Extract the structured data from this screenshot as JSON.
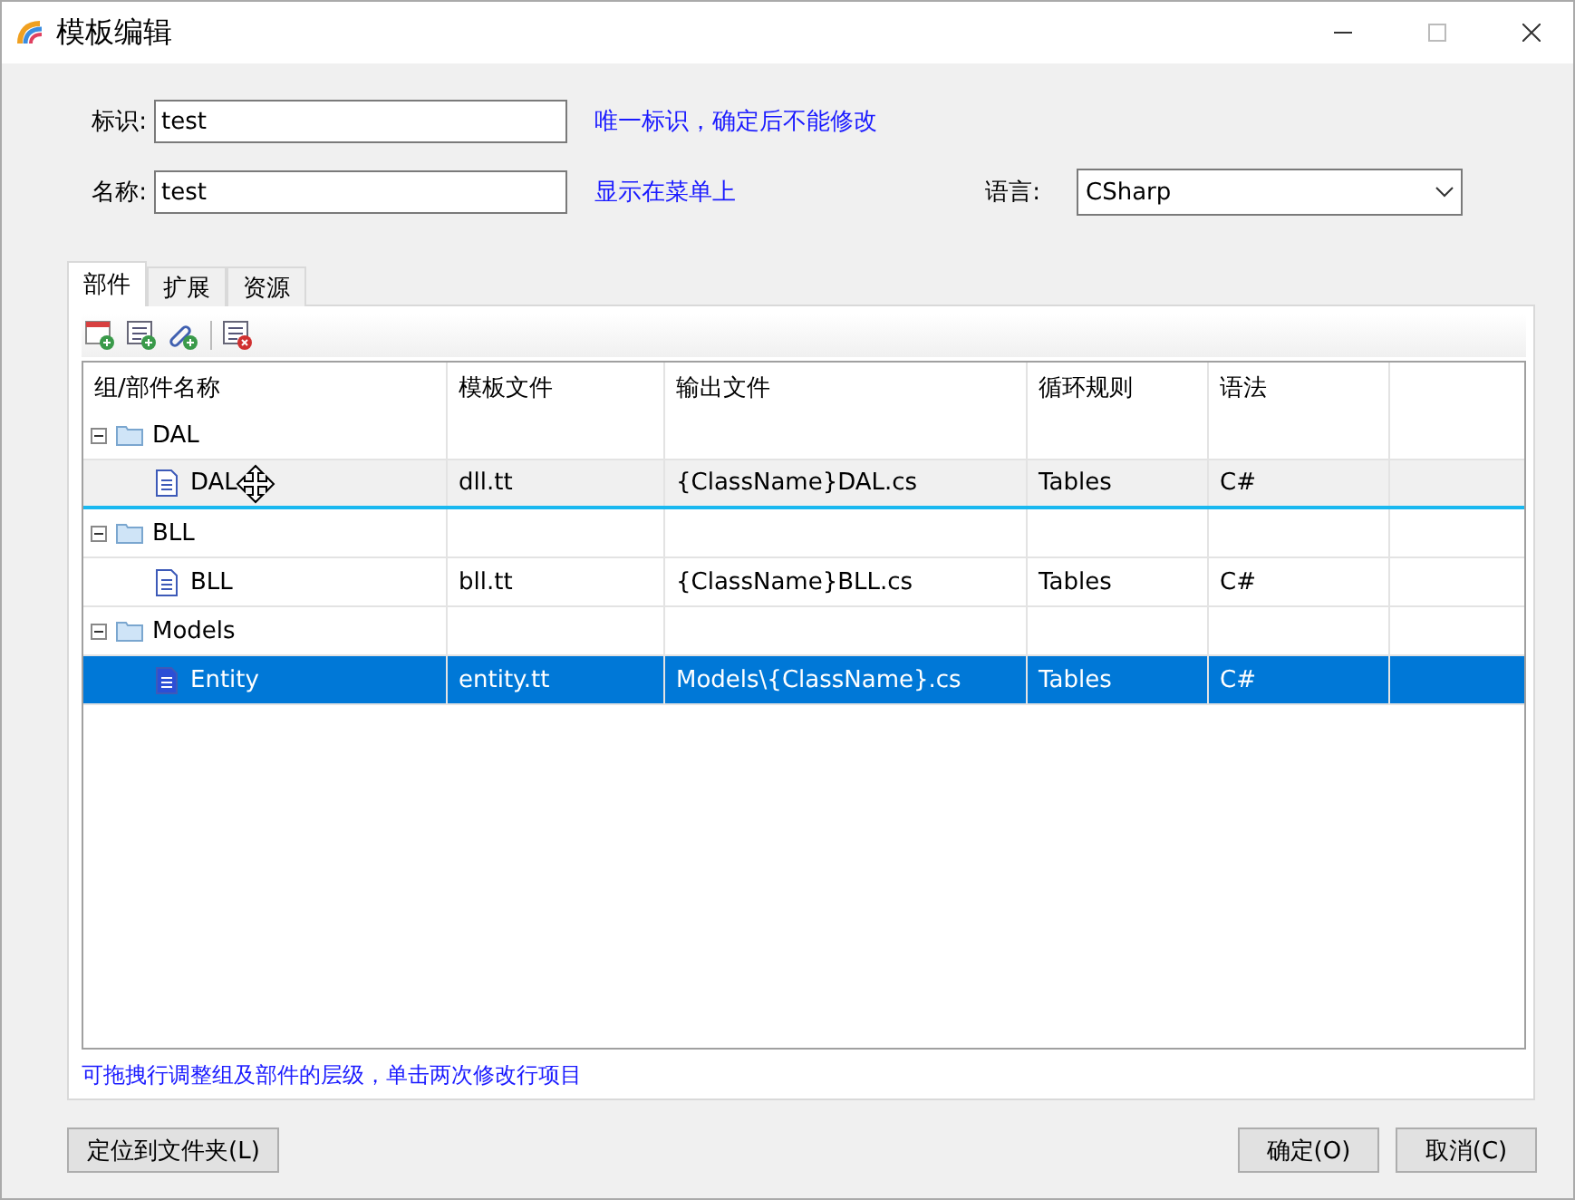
{
  "window": {
    "title": "模板编辑"
  },
  "fields": [
    {
      "label": "标识:",
      "value": "test",
      "hint": "唯一标识，确定后不能修改"
    },
    {
      "label": "名称:",
      "value": "test",
      "hint": "显示在菜单上"
    }
  ],
  "language": {
    "label": "语言:",
    "value": "CSharp"
  },
  "tabs": [
    {
      "label": "部件",
      "selected": true
    },
    {
      "label": "扩展",
      "selected": false
    },
    {
      "label": "资源",
      "selected": false
    }
  ],
  "table": {
    "columns": [
      "组/部件名称",
      "模板文件",
      "输出文件",
      "循环规则",
      "语法"
    ],
    "groups": [
      {
        "name": "DAL",
        "expanded": true,
        "children": [
          {
            "cells": [
              "DAL",
              "dll.tt",
              "{ClassName}DAL.cs",
              "Tables",
              "C#"
            ],
            "selected": false,
            "drag_over": true
          }
        ]
      },
      {
        "name": "BLL",
        "expanded": true,
        "children": [
          {
            "cells": [
              "BLL",
              "bll.tt",
              "{ClassName}BLL.cs",
              "Tables",
              "C#"
            ],
            "selected": false,
            "drag_over": false
          }
        ]
      },
      {
        "name": "Models",
        "expanded": true,
        "children": [
          {
            "cells": [
              "Entity",
              "entity.tt",
              "Models\\{ClassName}.cs",
              "Tables",
              "C#"
            ],
            "selected": true,
            "drag_over": false
          }
        ]
      }
    ]
  },
  "hint": "可拖拽行调整组及部件的层级，单击两次修改行项目",
  "buttons": {
    "left": "定位到文件夹(L)",
    "ok": "确定(O)",
    "cancel": "取消(C)"
  }
}
